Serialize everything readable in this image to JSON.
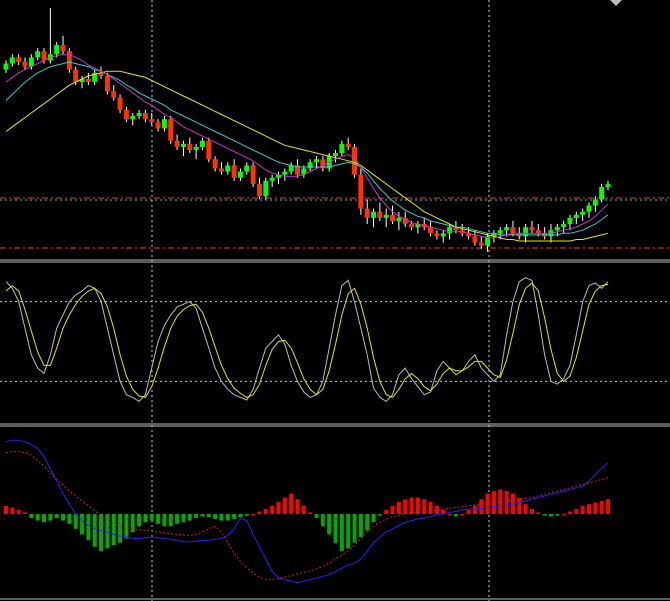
{
  "colors": {
    "background": "#000000",
    "bull_candle": "#00ff00",
    "bear_candle": "#ff3300",
    "wick": "#ffffff",
    "ma_fast": "#cc33cc",
    "ma_mid": "#33cccc",
    "ma_slow": "#e6e600",
    "stoch_main": "#bbbbbb",
    "stoch_signal": "#e6e600",
    "macd_line": "#2222ff",
    "signal_line": "#cc2222",
    "hist_pos": "#ff0000",
    "hist_neg": "#00aa00",
    "grid": "#cccccc",
    "level_line": "#ff3333",
    "panel_separator": "#bbbbbb"
  },
  "chart_data": [
    {
      "type": "candlestick",
      "panel": "price",
      "ylim": [
        0,
        100
      ],
      "candles": [
        [
          60,
          66,
          58,
          64
        ],
        [
          64,
          70,
          62,
          68
        ],
        [
          68,
          70,
          63,
          65
        ],
        [
          65,
          68,
          60,
          62
        ],
        [
          62,
          70,
          60,
          68
        ],
        [
          68,
          74,
          66,
          72
        ],
        [
          72,
          74,
          64,
          66
        ],
        [
          66,
          100,
          64,
          70
        ],
        [
          70,
          78,
          68,
          76
        ],
        [
          76,
          82,
          70,
          72
        ],
        [
          72,
          74,
          58,
          60
        ],
        [
          60,
          62,
          50,
          52
        ],
        [
          52,
          56,
          48,
          54
        ],
        [
          54,
          58,
          50,
          52
        ],
        [
          52,
          60,
          50,
          58
        ],
        [
          58,
          62,
          54,
          56
        ],
        [
          56,
          58,
          44,
          46
        ],
        [
          46,
          50,
          40,
          42
        ],
        [
          42,
          44,
          32,
          34
        ],
        [
          34,
          36,
          26,
          28
        ],
        [
          28,
          32,
          24,
          30
        ],
        [
          30,
          34,
          28,
          32
        ],
        [
          32,
          34,
          26,
          28
        ],
        [
          28,
          32,
          24,
          26
        ],
        [
          26,
          28,
          20,
          22
        ],
        [
          22,
          30,
          20,
          28
        ],
        [
          28,
          30,
          12,
          14
        ],
        [
          14,
          18,
          8,
          10
        ],
        [
          10,
          14,
          4,
          12
        ],
        [
          12,
          16,
          6,
          8
        ],
        [
          8,
          12,
          2,
          10
        ],
        [
          10,
          16,
          8,
          14
        ],
        [
          14,
          16,
          0,
          2
        ],
        [
          2,
          4,
          -6,
          -4
        ],
        [
          -4,
          0,
          -8,
          -6
        ],
        [
          -6,
          0,
          -8,
          -2
        ],
        [
          -2,
          2,
          -12,
          -10
        ],
        [
          -10,
          -4,
          -12,
          -6
        ],
        [
          -6,
          0,
          -8,
          -2
        ],
        [
          -2,
          0,
          -16,
          -14
        ],
        [
          -14,
          -10,
          -24,
          -22
        ],
        [
          -22,
          -10,
          -24,
          -12
        ],
        [
          -12,
          -8,
          -16,
          -10
        ],
        [
          -10,
          -6,
          -14,
          -8
        ],
        [
          -8,
          -4,
          -12,
          -6
        ],
        [
          -6,
          0,
          -8,
          -2
        ],
        [
          -2,
          2,
          -10,
          -8
        ],
        [
          -8,
          -2,
          -10,
          -4
        ],
        [
          -4,
          2,
          -6,
          0
        ],
        [
          0,
          4,
          -4,
          2
        ],
        [
          2,
          4,
          -6,
          -4
        ],
        [
          -4,
          6,
          -6,
          4
        ],
        [
          4,
          8,
          0,
          6
        ],
        [
          6,
          14,
          4,
          12
        ],
        [
          12,
          16,
          8,
          10
        ],
        [
          10,
          12,
          -10,
          -8
        ],
        [
          -8,
          -4,
          -34,
          -30
        ],
        [
          -30,
          -24,
          -40,
          -36
        ],
        [
          -36,
          -30,
          -42,
          -32
        ],
        [
          -32,
          -26,
          -38,
          -36
        ],
        [
          -36,
          -30,
          -42,
          -34
        ],
        [
          -34,
          -28,
          -40,
          -38
        ],
        [
          -38,
          -32,
          -44,
          -36
        ],
        [
          -36,
          -32,
          -42,
          -40
        ],
        [
          -40,
          -38,
          -44,
          -42
        ],
        [
          -42,
          -38,
          -46,
          -40
        ],
        [
          -40,
          -36,
          -44,
          -42
        ],
        [
          -42,
          -38,
          -48,
          -46
        ],
        [
          -46,
          -44,
          -50,
          -48
        ],
        [
          -48,
          -44,
          -52,
          -46
        ],
        [
          -46,
          -40,
          -50,
          -42
        ],
        [
          -42,
          -38,
          -46,
          -44
        ],
        [
          -44,
          -40,
          -48,
          -46
        ],
        [
          -46,
          -42,
          -50,
          -48
        ],
        [
          -48,
          -44,
          -54,
          -52
        ],
        [
          -52,
          -48,
          -56,
          -54
        ],
        [
          -54,
          -46,
          -58,
          -48
        ],
        [
          -48,
          -44,
          -52,
          -46
        ],
        [
          -46,
          -42,
          -50,
          -44
        ],
        [
          -44,
          -40,
          -48,
          -42
        ],
        [
          -42,
          -38,
          -48,
          -46
        ],
        [
          -46,
          -42,
          -50,
          -48
        ],
        [
          -48,
          -40,
          -52,
          -42
        ],
        [
          -42,
          -38,
          -46,
          -44
        ],
        [
          -44,
          -40,
          -48,
          -46
        ],
        [
          -46,
          -42,
          -50,
          -48
        ],
        [
          -48,
          -40,
          -52,
          -44
        ],
        [
          -44,
          -40,
          -48,
          -42
        ],
        [
          -42,
          -38,
          -46,
          -40
        ],
        [
          -40,
          -34,
          -44,
          -36
        ],
        [
          -36,
          -32,
          -40,
          -34
        ],
        [
          -34,
          -30,
          -38,
          -32
        ],
        [
          -32,
          -26,
          -36,
          -28
        ],
        [
          -28,
          -22,
          -32,
          -24
        ],
        [
          -24,
          -14,
          -26,
          -16
        ],
        [
          -16,
          -12,
          -18,
          -14
        ]
      ],
      "ma_fast": [
        52,
        55,
        58,
        60,
        62,
        64,
        66,
        68,
        69,
        70,
        70,
        68,
        66,
        63,
        61,
        59,
        57,
        54,
        51,
        48,
        45,
        42,
        39,
        37,
        34,
        31,
        29,
        26,
        23,
        21,
        19,
        17,
        15,
        13,
        11,
        9,
        7,
        5,
        3,
        1,
        -2,
        -5,
        -7,
        -8,
        -9,
        -9,
        -9,
        -8,
        -6,
        -4,
        -2,
        0,
        2,
        4,
        5,
        3,
        -3,
        -10,
        -17,
        -23,
        -28,
        -32,
        -35,
        -37,
        -39,
        -40,
        -41,
        -42,
        -43,
        -44,
        -45,
        -45,
        -45,
        -46,
        -47,
        -48,
        -49,
        -49,
        -48,
        -47,
        -46,
        -46,
        -46,
        -46,
        -46,
        -46,
        -46,
        -45,
        -44,
        -43,
        -42,
        -40,
        -38,
        -35,
        -31,
        -27
      ],
      "ma_mid": [
        40,
        44,
        48,
        52,
        55,
        58,
        60,
        62,
        63,
        64,
        65,
        64,
        63,
        62,
        60,
        59,
        57,
        55,
        53,
        50,
        48,
        45,
        43,
        41,
        39,
        37,
        34,
        32,
        30,
        28,
        26,
        24,
        22,
        20,
        18,
        16,
        14,
        12,
        10,
        8,
        6,
        4,
        2,
        0,
        -1,
        -2,
        -3,
        -3,
        -3,
        -3,
        -3,
        -3,
        -2,
        -1,
        0,
        -1,
        -3,
        -7,
        -12,
        -17,
        -21,
        -25,
        -28,
        -31,
        -33,
        -35,
        -36,
        -38,
        -39,
        -40,
        -41,
        -42,
        -42,
        -43,
        -44,
        -45,
        -46,
        -46,
        -47,
        -47,
        -47,
        -47,
        -47,
        -47,
        -47,
        -47,
        -47,
        -47,
        -46,
        -46,
        -45,
        -44,
        -42,
        -40,
        -37,
        -34
      ],
      "ma_slow": [
        20,
        23,
        26,
        29,
        32,
        35,
        38,
        41,
        44,
        47,
        50,
        52,
        54,
        56,
        57,
        58,
        59,
        59,
        59,
        58,
        57,
        56,
        55,
        53,
        51,
        49,
        47,
        45,
        43,
        41,
        39,
        37,
        35,
        33,
        31,
        29,
        27,
        25,
        23,
        21,
        19,
        17,
        15,
        13,
        11,
        10,
        9,
        8,
        7,
        6,
        5,
        4,
        3,
        2,
        1,
        0,
        -2,
        -5,
        -8,
        -11,
        -14,
        -17,
        -20,
        -23,
        -26,
        -29,
        -32,
        -34,
        -36,
        -38,
        -40,
        -42,
        -43,
        -44,
        -45,
        -46,
        -47,
        -48,
        -49,
        -50,
        -50,
        -51,
        -51,
        -51,
        -51,
        -51,
        -51,
        -51,
        -51,
        -51,
        -50,
        -50,
        -49,
        -48,
        -47,
        -46
      ],
      "level_lines": [
        -16,
        -16,
        -60
      ]
    },
    {
      "type": "line",
      "panel": "stochastic",
      "ylim": [
        0,
        100
      ],
      "levels": [
        80,
        20
      ],
      "series": [
        {
          "key": "stoch_main",
          "values": [
            95,
            90,
            80,
            60,
            40,
            30,
            26,
            40,
            60,
            70,
            80,
            85,
            88,
            92,
            90,
            80,
            60,
            40,
            20,
            10,
            8,
            5,
            10,
            30,
            50,
            62,
            70,
            76,
            78,
            80,
            75,
            60,
            45,
            30,
            20,
            14,
            10,
            8,
            6,
            14,
            30,
            45,
            50,
            55,
            48,
            32,
            20,
            12,
            8,
            10,
            20,
            45,
            70,
            92,
            96,
            80,
            60,
            40,
            15,
            8,
            5,
            10,
            25,
            30,
            22,
            16,
            10,
            12,
            28,
            35,
            30,
            25,
            28,
            35,
            40,
            30,
            25,
            20,
            25,
            55,
            80,
            95,
            98,
            96,
            70,
            40,
            20,
            18,
            22,
            32,
            55,
            80,
            92,
            94,
            90,
            95
          ]
        },
        {
          "key": "stoch_signal",
          "values": [
            88,
            92,
            88,
            74,
            58,
            42,
            32,
            32,
            45,
            60,
            70,
            78,
            84,
            88,
            90,
            86,
            76,
            60,
            40,
            24,
            14,
            9,
            8,
            16,
            30,
            46,
            60,
            69,
            74,
            77,
            78,
            72,
            60,
            46,
            32,
            22,
            15,
            11,
            8,
            10,
            18,
            32,
            44,
            50,
            51,
            45,
            34,
            22,
            14,
            10,
            14,
            28,
            48,
            70,
            86,
            90,
            78,
            60,
            38,
            20,
            10,
            8,
            14,
            22,
            26,
            22,
            16,
            13,
            18,
            26,
            30,
            28,
            28,
            31,
            35,
            35,
            30,
            25,
            23,
            36,
            56,
            78,
            90,
            94,
            88,
            68,
            44,
            26,
            20,
            24,
            38,
            58,
            78,
            88,
            92,
            93
          ]
        }
      ]
    },
    {
      "type": "bar",
      "panel": "macd",
      "ylim": [
        -100,
        100
      ],
      "histogram": [
        10,
        8,
        5,
        2,
        -5,
        -8,
        -10,
        -8,
        -5,
        -8,
        -12,
        -18,
        -25,
        -32,
        -40,
        -45,
        -42,
        -38,
        -35,
        -30,
        -22,
        -15,
        -10,
        -8,
        -12,
        -15,
        -15,
        -12,
        -10,
        -8,
        -5,
        -3,
        -4,
        -6,
        -8,
        -8,
        -6,
        -4,
        -2,
        0,
        3,
        6,
        10,
        15,
        20,
        25,
        18,
        10,
        2,
        -5,
        -15,
        -25,
        -35,
        -45,
        -42,
        -35,
        -28,
        -20,
        -10,
        -2,
        5,
        10,
        15,
        18,
        20,
        20,
        18,
        15,
        10,
        5,
        0,
        -3,
        0,
        5,
        10,
        18,
        25,
        28,
        30,
        28,
        25,
        20,
        12,
        6,
        2,
        -2,
        -3,
        -2,
        0,
        3,
        6,
        10,
        12,
        14,
        16,
        18
      ],
      "series": [
        {
          "key": "macd_line",
          "values": [
            88,
            90,
            90,
            88,
            85,
            80,
            70,
            55,
            40,
            25,
            12,
            0,
            -8,
            -14,
            -18,
            -20,
            -22,
            -25,
            -27,
            -28,
            -30,
            -30,
            -29,
            -28,
            -29,
            -30,
            -31,
            -32,
            -34,
            -34,
            -33,
            -32,
            -32,
            -31,
            -30,
            -26,
            -18,
            -5,
            -8,
            -25,
            -40,
            -55,
            -70,
            -78,
            -80,
            -82,
            -84,
            -82,
            -80,
            -78,
            -76,
            -74,
            -70,
            -66,
            -62,
            -60,
            -55,
            -45,
            -35,
            -28,
            -22,
            -18,
            -14,
            -10,
            -8,
            -6,
            -5,
            -3,
            -1,
            0,
            2,
            3,
            5,
            6,
            6,
            7,
            8,
            9,
            10,
            11,
            12,
            14,
            16,
            18,
            20,
            22,
            24,
            26,
            28,
            30,
            32,
            34,
            40,
            48,
            56,
            62
          ],
          "values_alt": []
        },
        {
          "key": "signal_line",
          "values": [
            75,
            76,
            76,
            75,
            72,
            65,
            58,
            50,
            42,
            35,
            28,
            22,
            16,
            10,
            4,
            -2,
            -8,
            -12,
            -15,
            -17,
            -18,
            -19,
            -20,
            -21,
            -22,
            -23,
            -24,
            -25,
            -26,
            -26,
            -25,
            -22,
            -18,
            -15,
            -22,
            -35,
            -48,
            -58,
            -66,
            -72,
            -77,
            -80,
            -80,
            -79,
            -77,
            -75,
            -73,
            -71,
            -69,
            -67,
            -64,
            -60,
            -55,
            -50,
            -45,
            -38,
            -30,
            -22,
            -15,
            -10,
            -6,
            -3,
            -2,
            0,
            1,
            2,
            3,
            4,
            5,
            6,
            7,
            8,
            9,
            10,
            11,
            12,
            13,
            14,
            15,
            16,
            17,
            18,
            19,
            20,
            22,
            24,
            26,
            28,
            30,
            32,
            34,
            36,
            38,
            40,
            42,
            44
          ]
        }
      ]
    }
  ]
}
